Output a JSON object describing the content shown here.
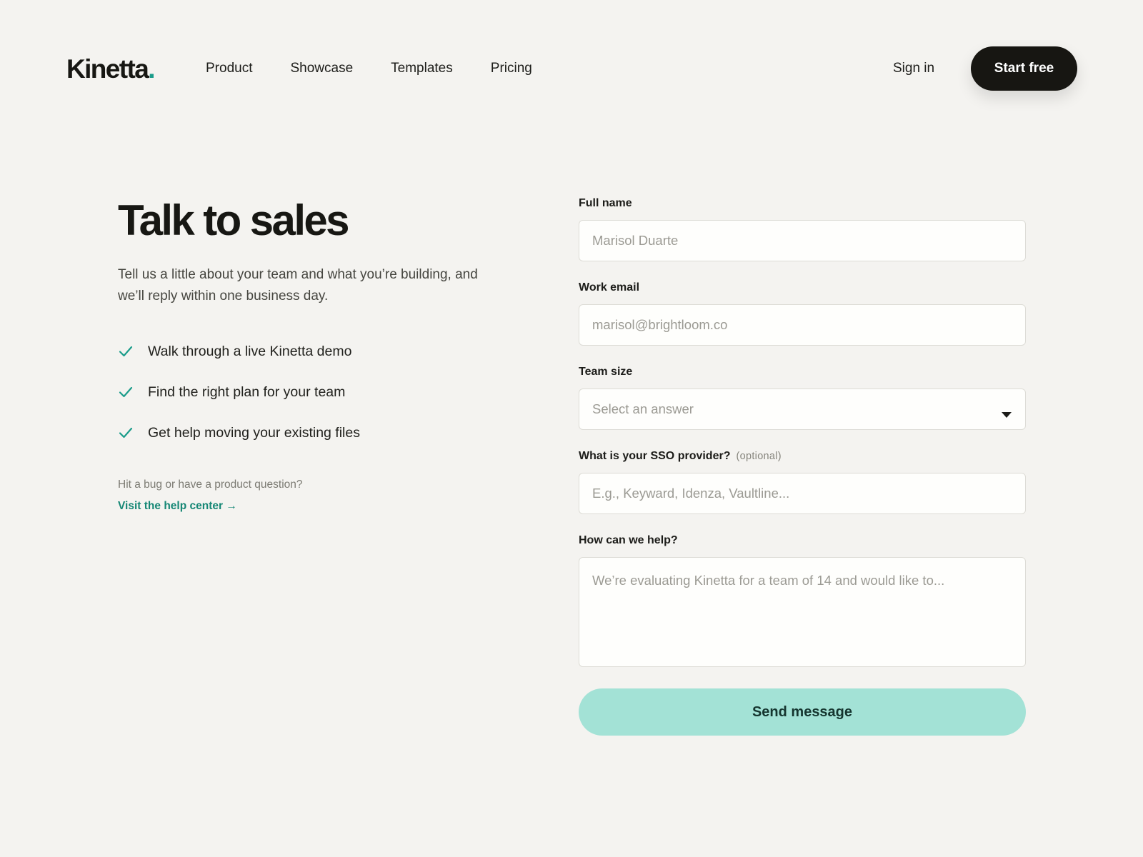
{
  "brand": {
    "name": "Kinetta",
    "dot": ".",
    "accent_color": "#1a9c8a"
  },
  "nav": {
    "items": [
      {
        "label": "Product"
      },
      {
        "label": "Showcase"
      },
      {
        "label": "Templates"
      },
      {
        "label": "Pricing"
      }
    ],
    "sign_in": "Sign in",
    "start_free": "Start free"
  },
  "hero": {
    "title": "Talk to sales",
    "subtitle": "Tell us a little about your team and what you’re building, and we’ll reply within one business day.",
    "checklist": [
      "Walk through a live Kinetta demo",
      "Find the right plan for your team",
      "Get help moving your existing files"
    ],
    "help_question": "Hit a bug or have a product question?",
    "help_link": "Visit the help center →"
  },
  "form": {
    "full_name": {
      "label": "Full name",
      "placeholder": "Marisol Duarte",
      "value": ""
    },
    "work_email": {
      "label": "Work email",
      "placeholder": "marisol@brightloom.co",
      "value": ""
    },
    "team_size": {
      "label": "Team size",
      "selected": "Select an answer"
    },
    "sso": {
      "label": "What is your SSO provider?",
      "optional": "(optional)",
      "placeholder": "E.g., Keyward, Idenza, Vaultline...",
      "value": ""
    },
    "help": {
      "label": "How can we help?",
      "placeholder": "We’re evaluating Kinetta for a team of 14 and would like to...",
      "value": ""
    },
    "submit": "Send message"
  }
}
